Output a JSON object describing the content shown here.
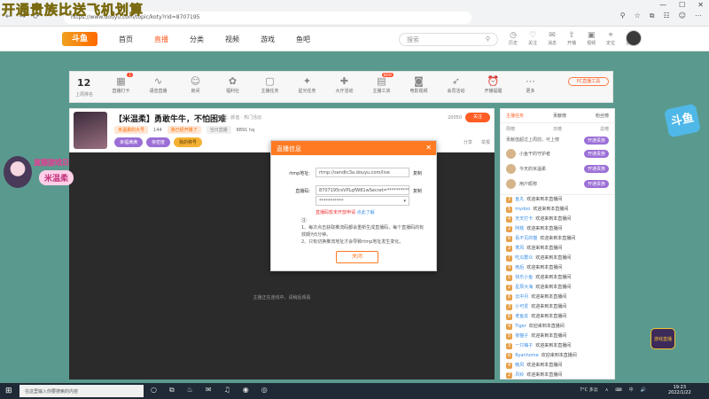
{
  "overlay": {
    "title": "开通贵族比送飞机划算"
  },
  "browser": {
    "url": "https://www.douyu.com/topic/koty?rid=8707195",
    "win": [
      "—",
      "☐",
      "✕"
    ]
  },
  "site": {
    "logo": "斗鱼",
    "nav": [
      "首页",
      "直播",
      "分类",
      "视频",
      "游戏",
      "鱼吧"
    ],
    "active_index": 1,
    "search_placeholder": "搜索",
    "icons": [
      {
        "icon": "clock-icon",
        "label": "历史"
      },
      {
        "icon": "heart-icon",
        "label": "关注"
      },
      {
        "icon": "chat-icon",
        "label": "消息"
      },
      {
        "icon": "upload-icon",
        "label": "开播"
      },
      {
        "icon": "video-icon",
        "label": "视频"
      },
      {
        "icon": "pin-icon",
        "label": "定位"
      },
      {
        "icon": "more-icon",
        "label": "更多"
      }
    ]
  },
  "toolbar": {
    "level": "12",
    "level_sub": "上周排名",
    "items": [
      {
        "icon": "calendar-icon",
        "label": "直播打卡",
        "badge": "1"
      },
      {
        "icon": "wave-icon",
        "label": "语音直播"
      },
      {
        "icon": "people-icon",
        "label": "房间"
      },
      {
        "icon": "gift-icon",
        "label": "福利社"
      },
      {
        "icon": "box-icon",
        "label": "主播任务"
      },
      {
        "icon": "star-icon",
        "label": "星光任务"
      },
      {
        "icon": "present-icon",
        "label": "大厅活动"
      },
      {
        "icon": "wallet-icon",
        "label": "主播工资",
        "badge": "NEW"
      },
      {
        "icon": "camera-icon",
        "label": "电影视频"
      },
      {
        "icon": "rocket-icon",
        "label": "会员活动"
      },
      {
        "icon": "alarm-icon",
        "label": "开播提醒"
      },
      {
        "icon": "more-icon",
        "label": "更多"
      }
    ],
    "pc_btn": "PC直播工具"
  },
  "room": {
    "title": "【米温柔】勇敢牛牛，不怕困难",
    "meta": "分区: 颜值 · 热门活动",
    "line2": [
      "米温柔的大号",
      "144",
      "我已经开播了",
      "当日直播",
      "8891 hq"
    ],
    "chips": [
      "幸福满满",
      "亲密度",
      "我的称号"
    ],
    "follow": "关注",
    "follow_count": "20050",
    "head_right": [
      "分享",
      "举报"
    ],
    "video_msg": "主播正在连线中，请稍后观看",
    "badge_t1": "直播游戏日",
    "badge_t2": "米温柔"
  },
  "rpanel": {
    "tabs": [
      "主播任务",
      "贡献榜",
      "粉丝榜"
    ],
    "sub": [
      "周榜",
      "日榜",
      "总榜"
    ],
    "info": "贡献值超过上周前，可上榜",
    "info_btn": "开通贵族",
    "ranks": [
      {
        "name": "小鱼干的守护者",
        "act": "开通贵族"
      },
      {
        "name": "今天的米温柔",
        "act": "开通贵族"
      },
      {
        "name": "用户昵称",
        "act": "开通贵族"
      }
    ],
    "chat": [
      {
        "lv": "3",
        "who": "鱼丸",
        "txt": "欢迎来到本直播间"
      },
      {
        "lv": "5",
        "who": "mydoo",
        "txt": "欢迎来到本直播间"
      },
      {
        "lv": "4",
        "who": "天天打卡",
        "txt": "欢迎来到本直播间"
      },
      {
        "lv": "2",
        "who": "阿桃",
        "txt": "欢迎来到本直播间"
      },
      {
        "lv": "6",
        "who": "看不见的猫",
        "txt": "欢迎来到本直播间"
      },
      {
        "lv": "3",
        "who": "寒风",
        "txt": "欢迎来到本直播间"
      },
      {
        "lv": "7",
        "who": "吃瓜群众",
        "txt": "欢迎来到本直播间"
      },
      {
        "lv": "4",
        "who": "雨后",
        "txt": "欢迎来到本直播间"
      },
      {
        "lv": "5",
        "who": "快乐小鱼",
        "txt": "欢迎来到本直播间"
      },
      {
        "lv": "2",
        "who": "星辰大海",
        "txt": "欢迎来到本直播间"
      },
      {
        "lv": "6",
        "who": "云中月",
        "txt": "欢迎来到本直播间"
      },
      {
        "lv": "3",
        "who": "小可爱",
        "txt": "欢迎来到本直播间"
      },
      {
        "lv": "8",
        "who": "老鱼友",
        "txt": "欢迎来到本直播间"
      },
      {
        "lv": "4",
        "who": "Tiger",
        "txt": "欢迎来到本直播间"
      },
      {
        "lv": "5",
        "who": "夜猫子",
        "txt": "欢迎来到本直播间"
      },
      {
        "lv": "3",
        "who": "一只柚子",
        "txt": "欢迎来到本直播间"
      },
      {
        "lv": "6",
        "who": "Ryanhome",
        "txt": "欢迎来到本直播间"
      },
      {
        "lv": "4",
        "who": "晚风",
        "txt": "欢迎来到本直播间"
      },
      {
        "lv": "2",
        "who": "风铃",
        "txt": "欢迎来到本直播间"
      }
    ]
  },
  "side": {
    "logo": "斗鱼",
    "corner": "游戏直播"
  },
  "modal": {
    "title": "直播信息",
    "close": "✕",
    "rtmp_label": "rtmp地址:",
    "rtmp_value": "rtmp://sendtc3a.douyu.com/live",
    "code_label": "直播码:",
    "code_value": "8707195rxVPLqfW81wSecret=*************",
    "third_value": "***********",
    "copy": "复制",
    "warn": "直播码暂未开放申请",
    "warn_link": "点此了解",
    "note1": "注:",
    "note2": "1、每次点击获取推流码都会重新生成直播码，每个直播码的有效期为5分钟。",
    "note3": "2、只有切换推流地址才会导致rtmp地址发生变化。",
    "btn": "关闭"
  },
  "taskbar": {
    "start": "⊞",
    "search": "在这里输入你要搜索的内容",
    "apps": [
      "○",
      "⧉",
      "♨",
      "✉",
      "♫",
      "◉",
      "◎"
    ],
    "right": [
      "7°C 多云",
      "∧",
      "⌨",
      "中",
      "🔊"
    ],
    "time": "19:23",
    "date": "2022/1/22"
  }
}
